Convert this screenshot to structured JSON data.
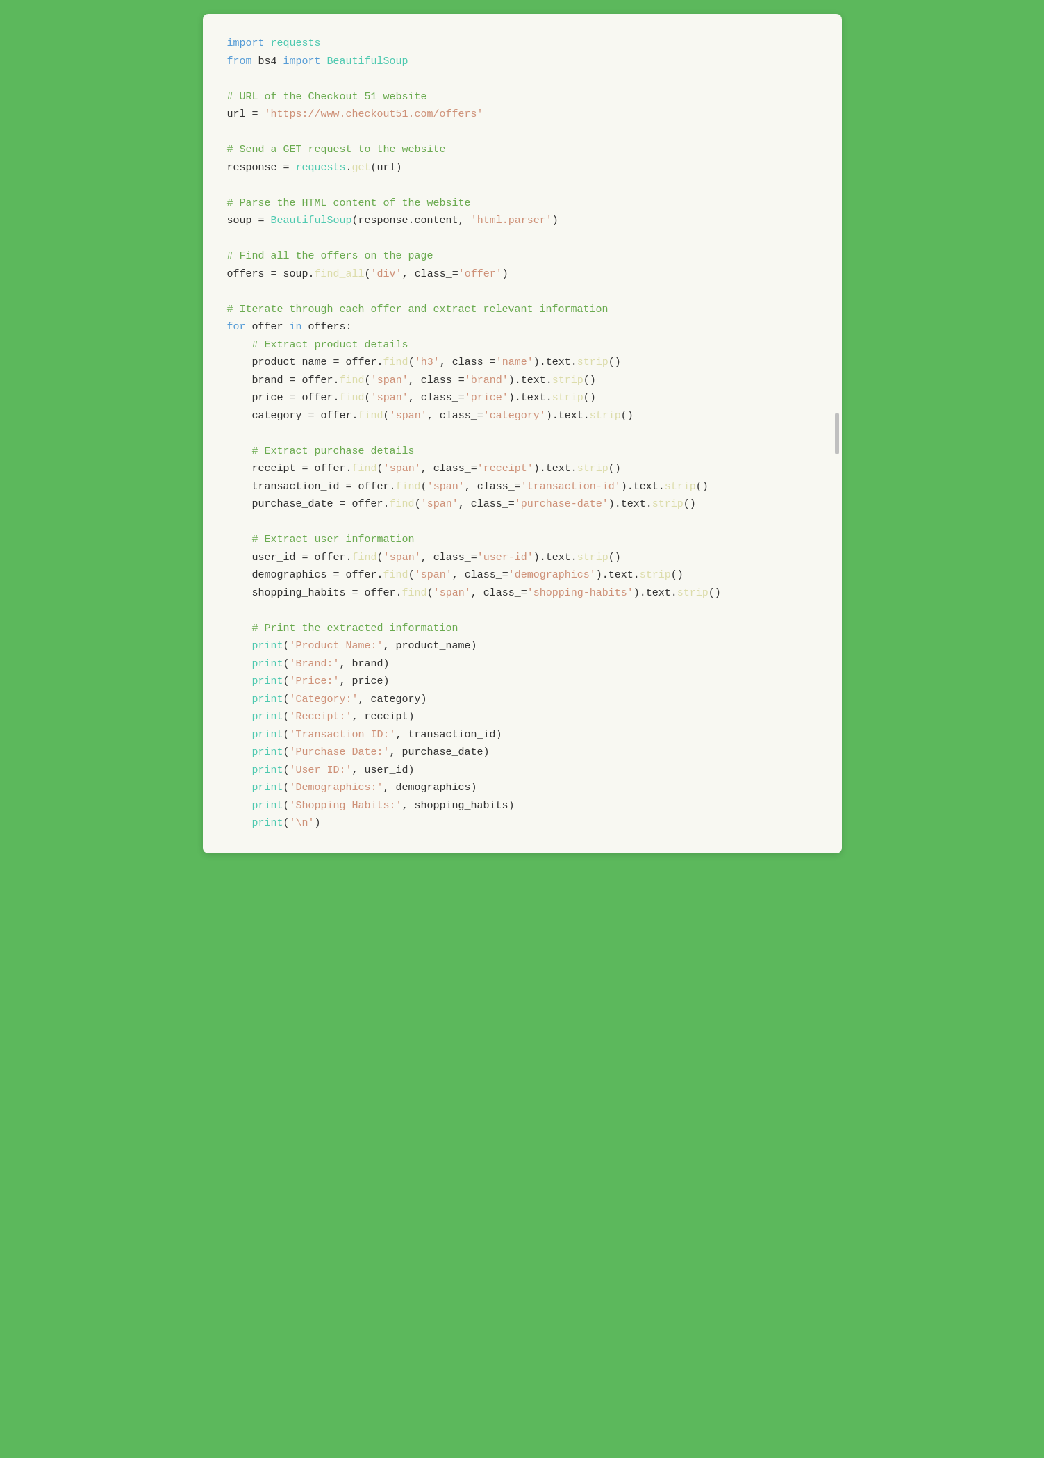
{
  "page": {
    "background_color": "#5cb85c",
    "container_bg": "#f8f8f2"
  },
  "code": {
    "lines": [
      {
        "type": "import",
        "text": "import requests"
      },
      {
        "type": "import",
        "text": "from bs4 import BeautifulSoup"
      },
      {
        "type": "blank"
      },
      {
        "type": "comment",
        "text": "# URL of the Checkout 51 website"
      },
      {
        "type": "code",
        "text": "url = 'https://www.checkout51.com/offers'"
      },
      {
        "type": "blank"
      },
      {
        "type": "comment",
        "text": "# Send a GET request to the website"
      },
      {
        "type": "code",
        "text": "response = requests.get(url)"
      },
      {
        "type": "blank"
      },
      {
        "type": "comment",
        "text": "# Parse the HTML content of the website"
      },
      {
        "type": "code",
        "text": "soup = BeautifulSoup(response.content, 'html.parser')"
      },
      {
        "type": "blank"
      },
      {
        "type": "comment",
        "text": "# Find all the offers on the page"
      },
      {
        "type": "code",
        "text": "offers = soup.find_all('div', class_='offer')"
      },
      {
        "type": "blank"
      },
      {
        "type": "comment",
        "text": "# Iterate through each offer and extract relevant information"
      },
      {
        "type": "code",
        "text": "for offer in offers:"
      },
      {
        "type": "code_indent",
        "text": "    # Extract product details"
      },
      {
        "type": "code_indent",
        "text": "    product_name = offer.find('h3', class_='name').text.strip()"
      },
      {
        "type": "code_indent",
        "text": "    brand = offer.find('span', class_='brand').text.strip()"
      },
      {
        "type": "code_indent",
        "text": "    price = offer.find('span', class_='price').text.strip()"
      },
      {
        "type": "code_indent",
        "text": "    category = offer.find('span', class_='category').text.strip()"
      },
      {
        "type": "blank"
      },
      {
        "type": "code_indent",
        "text": "    # Extract purchase details"
      },
      {
        "type": "code_indent",
        "text": "    receipt = offer.find('span', class_='receipt').text.strip()"
      },
      {
        "type": "code_indent",
        "text": "    transaction_id = offer.find('span', class_='transaction-id').text.strip()"
      },
      {
        "type": "code_indent",
        "text": "    purchase_date = offer.find('span', class_='purchase-date').text.strip()"
      },
      {
        "type": "blank"
      },
      {
        "type": "code_indent",
        "text": "    # Extract user information"
      },
      {
        "type": "code_indent",
        "text": "    user_id = offer.find('span', class_='user-id').text.strip()"
      },
      {
        "type": "code_indent",
        "text": "    demographics = offer.find('span', class_='demographics').text.strip()"
      },
      {
        "type": "code_indent",
        "text": "    shopping_habits = offer.find('span', class_='shopping-habits').text.strip()"
      },
      {
        "type": "blank"
      },
      {
        "type": "code_indent",
        "text": "    # Print the extracted information"
      },
      {
        "type": "code_indent",
        "text": "    print('Product Name:', product_name)"
      },
      {
        "type": "code_indent",
        "text": "    print('Brand:', brand)"
      },
      {
        "type": "code_indent",
        "text": "    print('Price:', price)"
      },
      {
        "type": "code_indent",
        "text": "    print('Category:', category)"
      },
      {
        "type": "code_indent",
        "text": "    print('Receipt:', receipt)"
      },
      {
        "type": "code_indent",
        "text": "    print('Transaction ID:', transaction_id)"
      },
      {
        "type": "code_indent",
        "text": "    print('Purchase Date:', purchase_date)"
      },
      {
        "type": "code_indent",
        "text": "    print('User ID:', user_id)"
      },
      {
        "type": "code_indent",
        "text": "    print('Demographics:', demographics)"
      },
      {
        "type": "code_indent",
        "text": "    print('Shopping Habits:', shopping_habits)"
      },
      {
        "type": "code_indent",
        "text": "    print('\\n')"
      }
    ]
  }
}
